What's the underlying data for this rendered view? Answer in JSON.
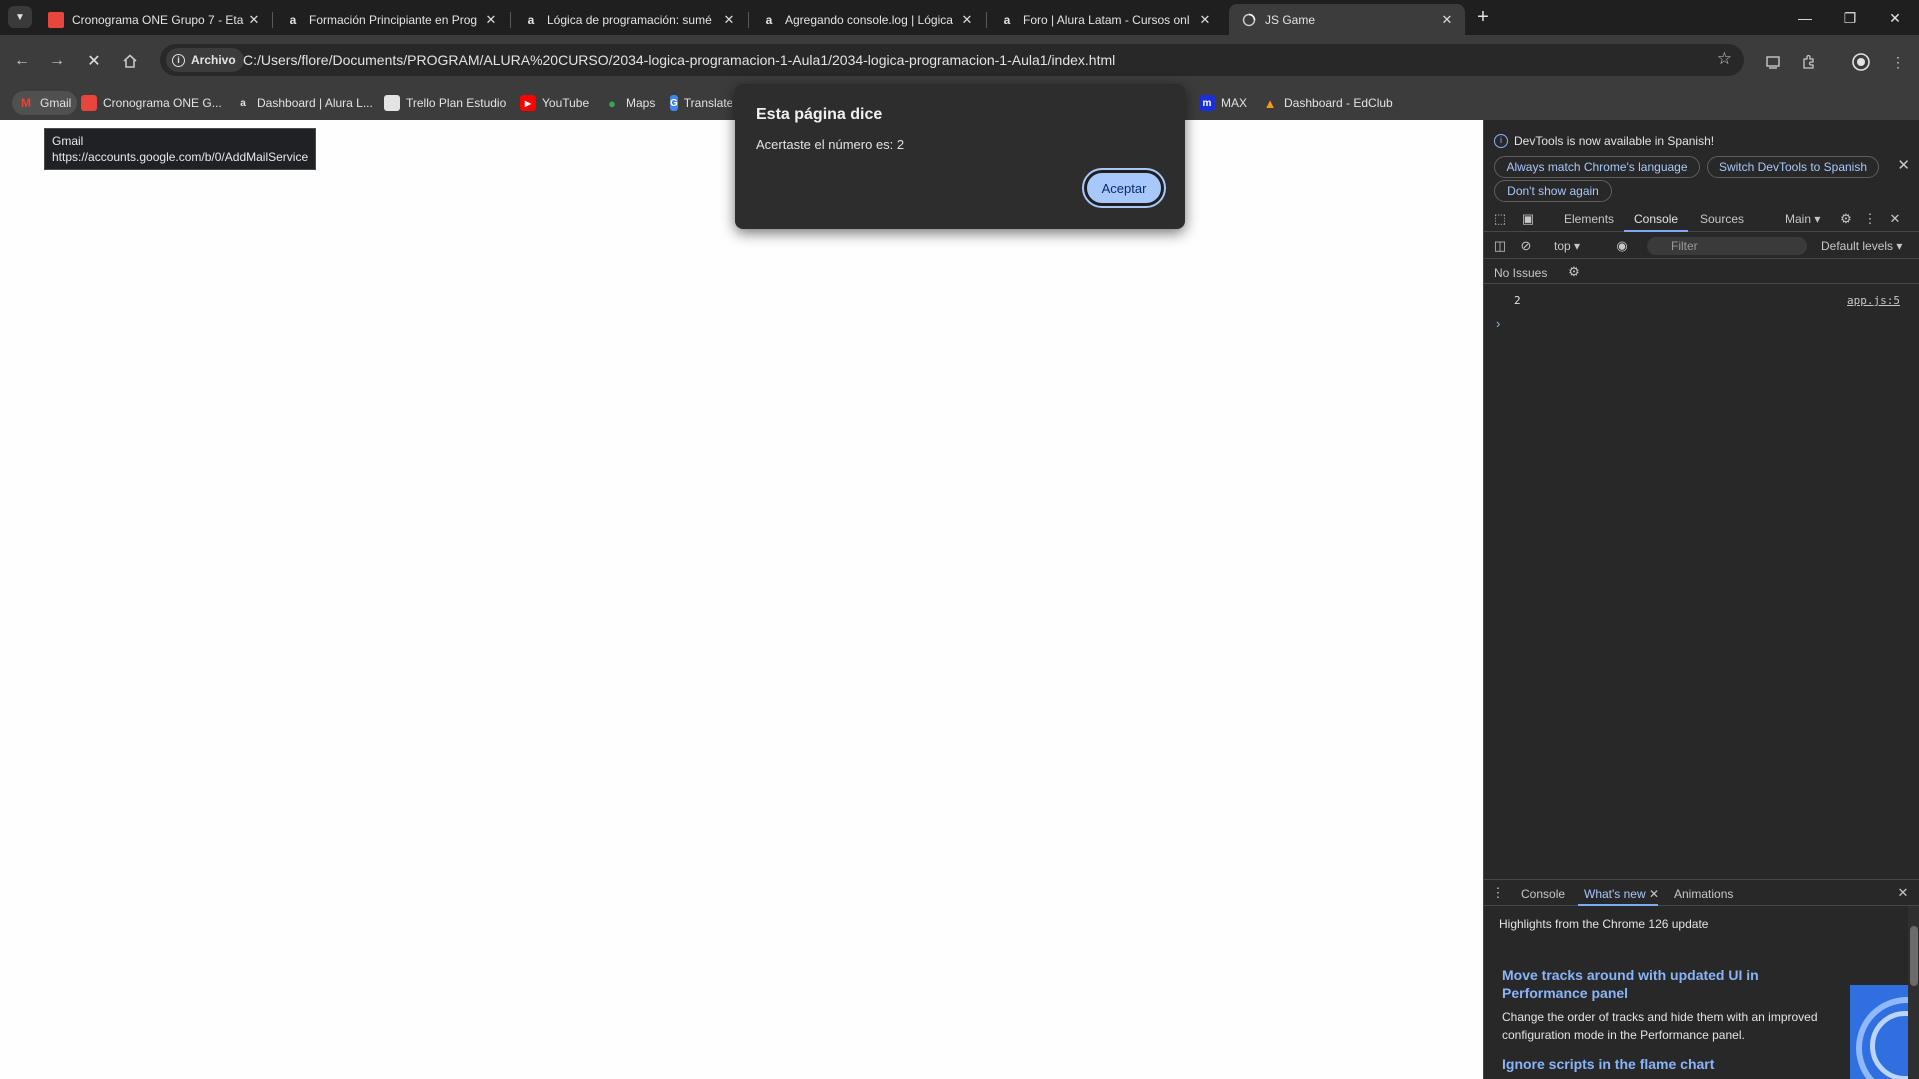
{
  "tabs": [
    {
      "title": "Cronograma ONE Grupo 7 - Eta",
      "favicon": "calendar-icon",
      "active": false
    },
    {
      "title": "Formación Principiante en Prog",
      "favicon": "alura-icon",
      "active": false
    },
    {
      "title": "Lógica de programación: sumé",
      "favicon": "alura-icon",
      "active": false
    },
    {
      "title": "Agregando console.log | Lógica",
      "favicon": "alura-icon",
      "active": false
    },
    {
      "title": "Foro | Alura Latam - Cursos onl",
      "favicon": "alura-icon",
      "active": false
    },
    {
      "title": "JS Game",
      "favicon": "loading-globe-icon",
      "active": true
    }
  ],
  "toolbar": {
    "chip_label": "Archivo",
    "url": "C:/Users/flore/Documents/PROGRAM/ALURA%20CURSO/2034-logica-programacion-1-Aula1/2034-logica-programacion-1-Aula1/index.html"
  },
  "bookmarks": [
    {
      "label": "Gmail",
      "icon": "gmail-icon"
    },
    {
      "label": "Cronograma ONE G...",
      "icon": "calendar-icon"
    },
    {
      "label": "Dashboard | Alura L...",
      "icon": "alura-icon"
    },
    {
      "label": "Trello Plan Estudio",
      "icon": "trello-icon"
    },
    {
      "label": "YouTube",
      "icon": "youtube-icon"
    },
    {
      "label": "Maps",
      "icon": "maps-icon"
    },
    {
      "label": "Translate",
      "icon": "translate-icon"
    },
    {
      "label": "MAX",
      "icon": "max-icon"
    },
    {
      "label": "Dashboard - EdClub",
      "icon": "edclub-icon"
    }
  ],
  "tooltip": {
    "title": "Gmail",
    "url": "https://accounts.google.com/b/0/AddMailService"
  },
  "dialog": {
    "title": "Esta página dice",
    "message": "Acertaste el número es: 2",
    "ok_label": "Aceptar"
  },
  "devtools": {
    "banner": {
      "message": "DevTools is now available in Spanish!",
      "match_label": "Always match Chrome's language",
      "switch_label": "Switch DevTools to Spanish",
      "dont_show_label": "Don't show again"
    },
    "tabs": [
      "Elements",
      "Console",
      "Sources"
    ],
    "active_tab": "Console",
    "main_label": "Main",
    "context": "top",
    "filter_placeholder": "Filter",
    "levels": "Default levels",
    "issues": "No Issues",
    "console": {
      "value": "2",
      "source": "app.js:5"
    },
    "drawer": {
      "tabs": [
        "Console",
        "What's new",
        "Animations"
      ],
      "active_tab": "What's new",
      "highlights": "Highlights from the Chrome 126 update",
      "card_title": "Move tracks around with updated UI in Performance panel",
      "card_body": "Change the order of tracks and hide them with an improved configuration mode in the Performance panel.",
      "next_title": "Ignore scripts in the flame chart"
    }
  },
  "colors": {
    "accent": "#a8c7fa",
    "link": "#8ab4f8",
    "chrome_bg": "#1f1f1f",
    "toolbar_bg": "#3c3c3c"
  }
}
